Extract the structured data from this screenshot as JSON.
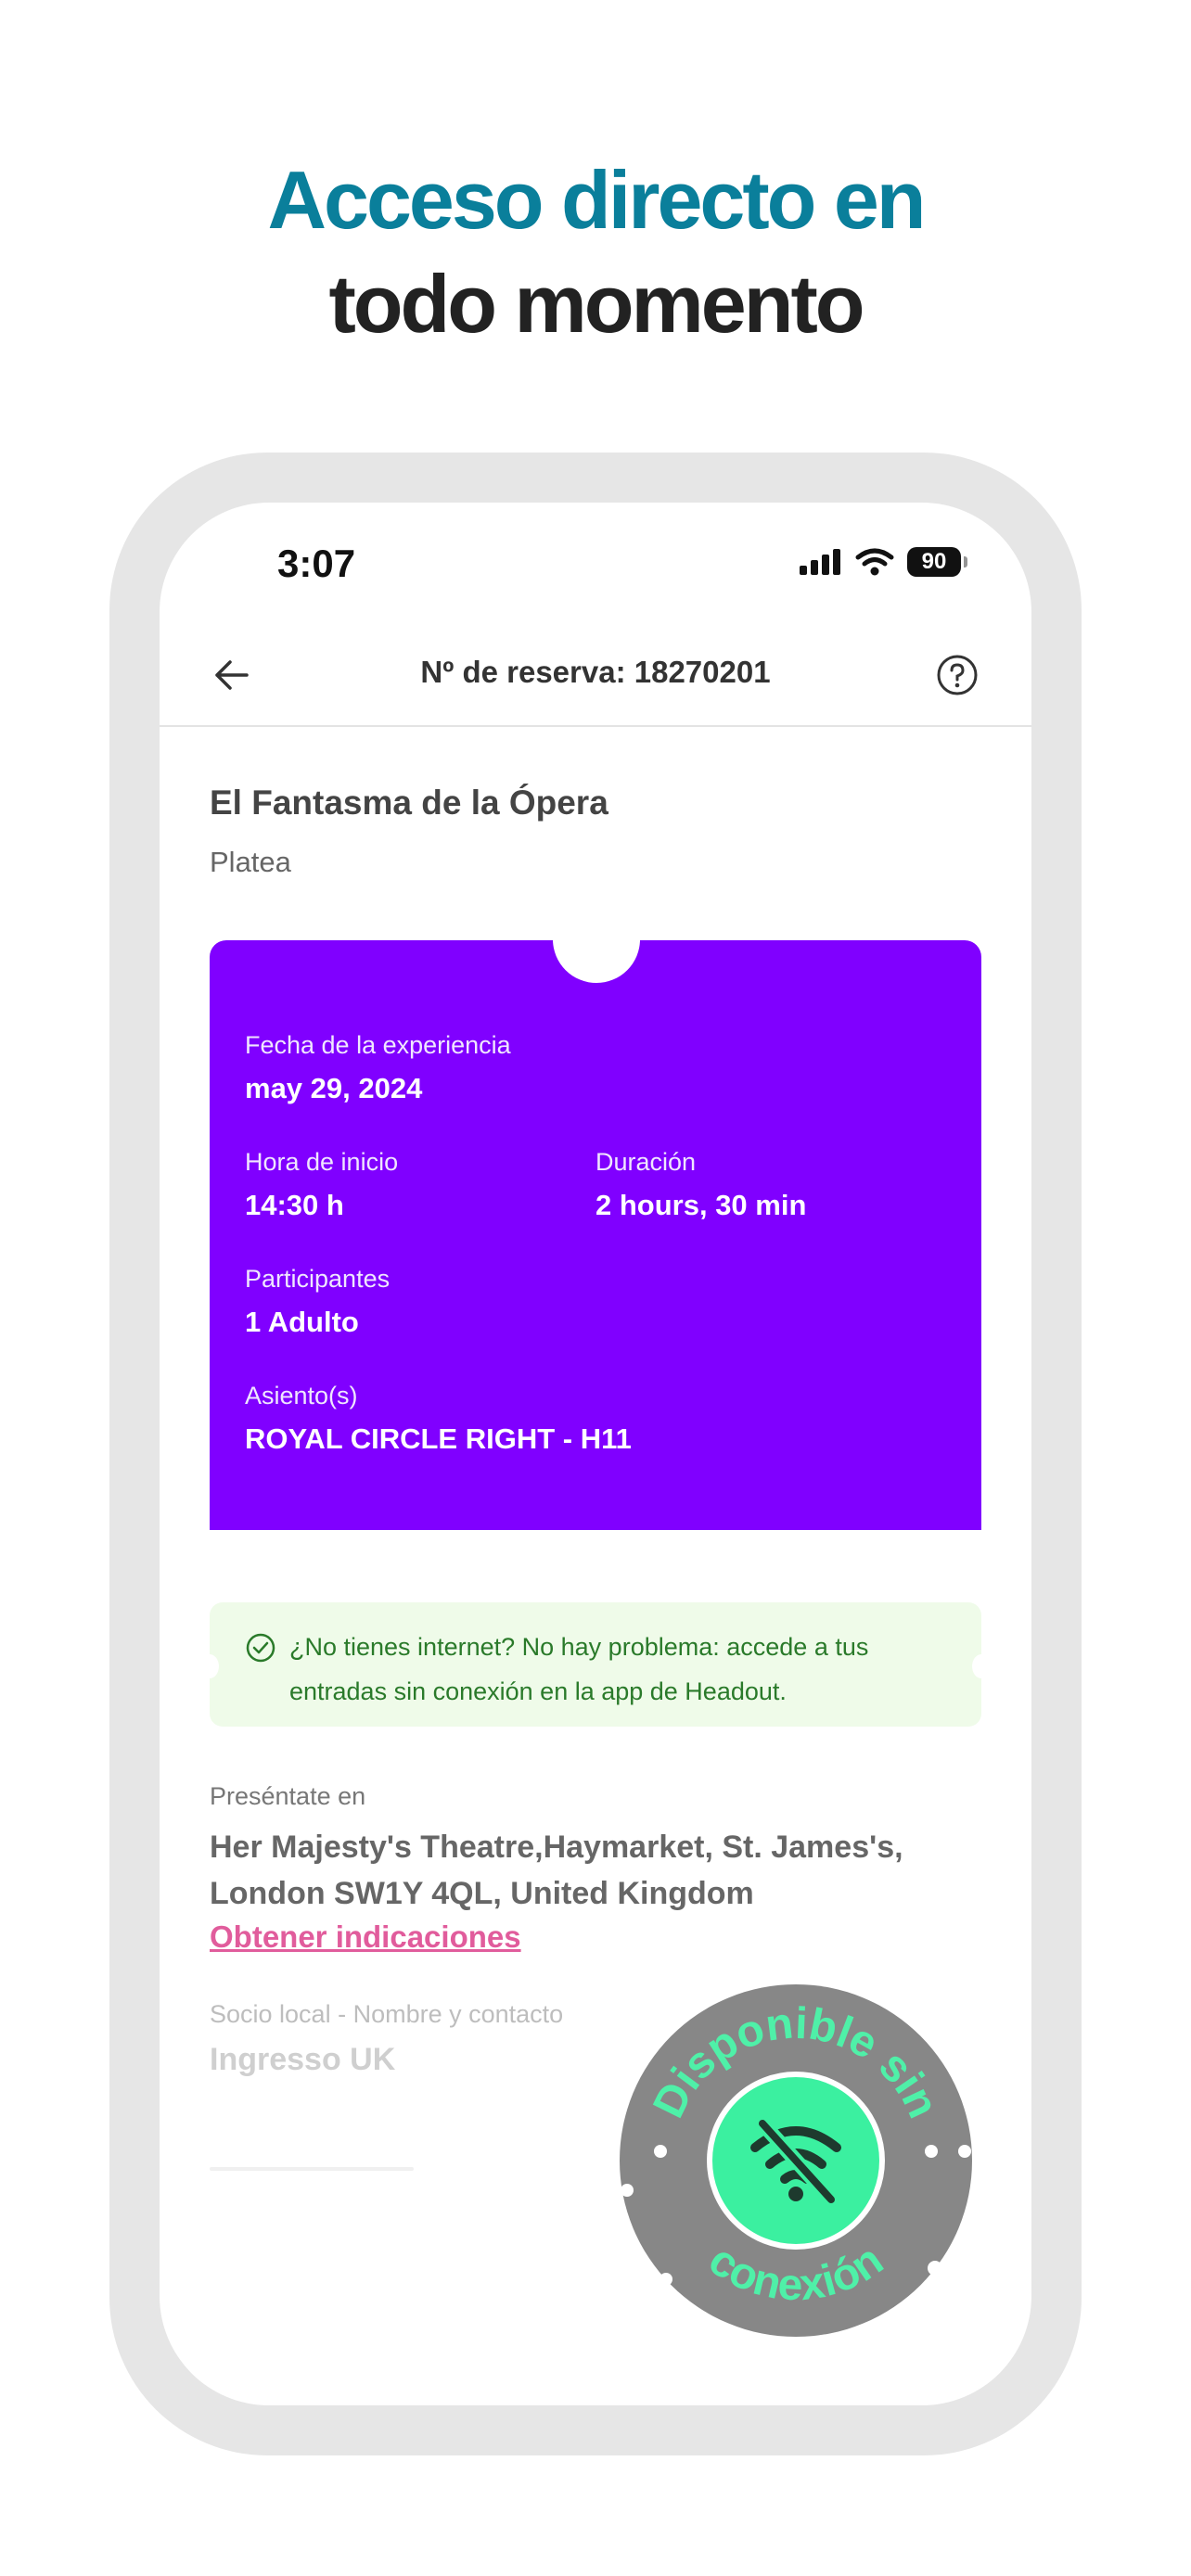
{
  "headline": {
    "line1": "Acceso directo en",
    "line2": "todo momento"
  },
  "status_bar": {
    "time": "3:07",
    "battery": "90"
  },
  "nav": {
    "title": "Nº de reserva: 18270201"
  },
  "event": {
    "title": "El Fantasma de la Ópera",
    "subtitle": "Platea"
  },
  "ticket": {
    "date_label": "Fecha de la experiencia",
    "date_value": "may 29, 2024",
    "start_label": "Hora de inicio",
    "start_value": "14:30 h",
    "duration_label": "Duración",
    "duration_value": "2 hours, 30 min",
    "participants_label": "Participantes",
    "participants_value": "1 Adulto",
    "seats_label": "Asiento(s)",
    "seats_value": "ROYAL CIRCLE RIGHT - H11"
  },
  "offline_note": {
    "text": "¿No tienes internet? No hay problema: accede a tus entradas sin conexión en la app de Headout."
  },
  "meeting": {
    "label": "Preséntate en",
    "address": "Her Majesty's Theatre,Haymarket, St. James's, London SW1Y 4QL, United Kingdom",
    "directions_link": "Obtener indicaciones"
  },
  "partner": {
    "label": "Socio local - Nombre y contacto",
    "value": "Ingresso UK"
  },
  "badge": {
    "top_text": "Disponible sin",
    "bottom_text": "conexión",
    "icon": "wifi-off-icon"
  },
  "colors": {
    "headline_accent": "#0a7f9b",
    "ticket_bg": "#8000ff",
    "offline_note_bg": "#effbe9",
    "link": "#e15c9c",
    "badge_bg": "#878787",
    "badge_accent": "#3bf0a0"
  }
}
